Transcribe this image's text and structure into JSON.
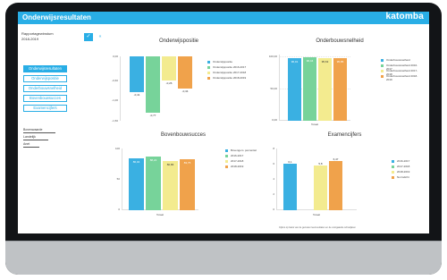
{
  "app": {
    "title": "Onderwijsresultaten",
    "logo": "katomba"
  },
  "sidebar": {
    "school_name": "Rapportagewinstum",
    "year": "2018-2019",
    "items": [
      {
        "label": "Onderwijsresultaten",
        "active": true
      },
      {
        "label": "Onderwijspositie",
        "active": false
      },
      {
        "label": "Onderbouwsnelheid",
        "active": false
      },
      {
        "label": "Bovenbouwsucces",
        "active": false
      },
      {
        "label": "Examencijfers",
        "active": false
      }
    ],
    "legend": [
      {
        "label": "Bovenwaarde",
        "fill": 0.72
      },
      {
        "label": "Landelijk",
        "fill": 0.55
      },
      {
        "label": "Anet",
        "fill": 0.35
      }
    ]
  },
  "toolbar": {
    "primary_icon": "check-icon",
    "secondary_icon": "expand-icon"
  },
  "colors": {
    "accent": "#29aee6",
    "blue": "#3ab0e2",
    "green": "#77d39a",
    "yellow": "#f3eb8f",
    "orange": "#f0a24b"
  },
  "charts": [
    {
      "title": "Onderwijspositie",
      "yticks": [
        "0,00",
        "-0,60",
        "-1,00",
        "-1,50"
      ],
      "xlabel": "Totaal",
      "legend": [
        "Onderwijspositie",
        "Onderwijspositie 2016-2017",
        "Onderwijspositie 2017-2018",
        "Onderwijspositie 2018-2019"
      ],
      "values": [
        "-0,41",
        "-0,77",
        "-0,26",
        "-0,34"
      ]
    },
    {
      "title": "Onderbouwsnelheid",
      "yticks": [
        "100,00",
        "50,00",
        "0,00"
      ],
      "xlabel": "Totaal",
      "legend": [
        "Onderbouwsnelheid",
        "Onderbouwsnelheid 2016-2017",
        "Onderbouwsnelheid 2017-2018",
        "Onderbouwsnelheid 2018-2019"
      ],
      "values": [
        "96,01",
        "96,44",
        "95,63",
        "95,85"
      ]
    },
    {
      "title": "Bovenbouwsucces",
      "yticks": [
        "100",
        "50",
        "0"
      ],
      "xlabel": "Totaal",
      "legend": [
        "Bovengem. percentiel",
        "2016-2017",
        "2017-2018",
        "2018-2019"
      ],
      "values": [
        "86,04",
        "88,22",
        "80,86",
        "83,75"
      ]
    },
    {
      "title": "Examencijfers",
      "yticks": [
        "8",
        "6",
        "4",
        "2",
        "0"
      ],
      "xlabel": "Totaal",
      "legend": [
        "2016-2017",
        "2017-2018",
        "2018-2019",
        "Normdicht"
      ],
      "values": [
        "6,1",
        "",
        "5,8",
        "6,47"
      ]
    }
  ],
  "footnote": "Cijfers op basis van de gemeten leerresultaten en de voorgaande schooljaren"
}
